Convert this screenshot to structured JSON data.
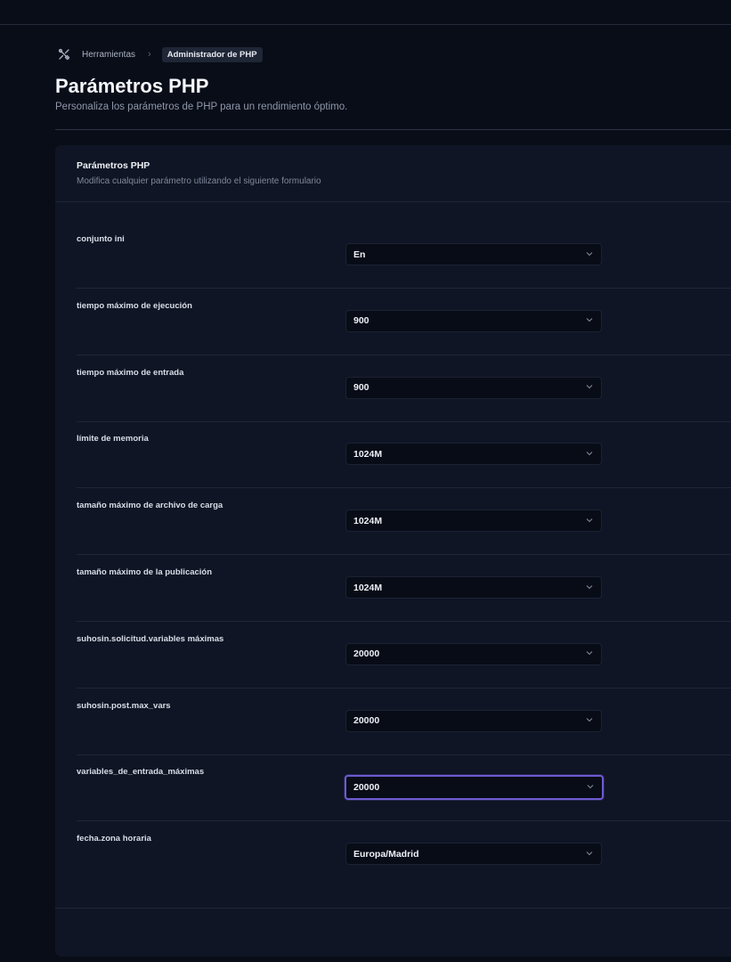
{
  "breadcrumb": {
    "icon": "tools-icon",
    "parent": "Herramientas",
    "current": "Administrador de PHP"
  },
  "page": {
    "title": "Parámetros PHP",
    "subtitle": "Personaliza los parámetros de PHP para un rendimiento óptimo."
  },
  "card": {
    "title": "Parámetros PHP",
    "subtitle": "Modifica cualquier parámetro utilizando el siguiente formulario"
  },
  "fields": [
    {
      "label": "conjunto ini",
      "value": "En"
    },
    {
      "label": "tiempo máximo de ejecución",
      "value": "900"
    },
    {
      "label": "tiempo máximo de entrada",
      "value": "900"
    },
    {
      "label": "límite de memoria",
      "value": "1024M"
    },
    {
      "label": "tamaño máximo de archivo de carga",
      "value": "1024M"
    },
    {
      "label": "tamaño máximo de la publicación",
      "value": "1024M"
    },
    {
      "label": "suhosin.solicitud.variables máximas",
      "value": "20000"
    },
    {
      "label": "suhosin.post.max_vars",
      "value": "20000"
    },
    {
      "label": "variables_de_entrada_máximas",
      "value": "20000"
    },
    {
      "label": "fecha.zona horaria",
      "value": "Europa/Madrid"
    }
  ],
  "colors": {
    "background": "#090d18",
    "card": "#0f1524",
    "focus_accent": "#6d5bd0"
  }
}
